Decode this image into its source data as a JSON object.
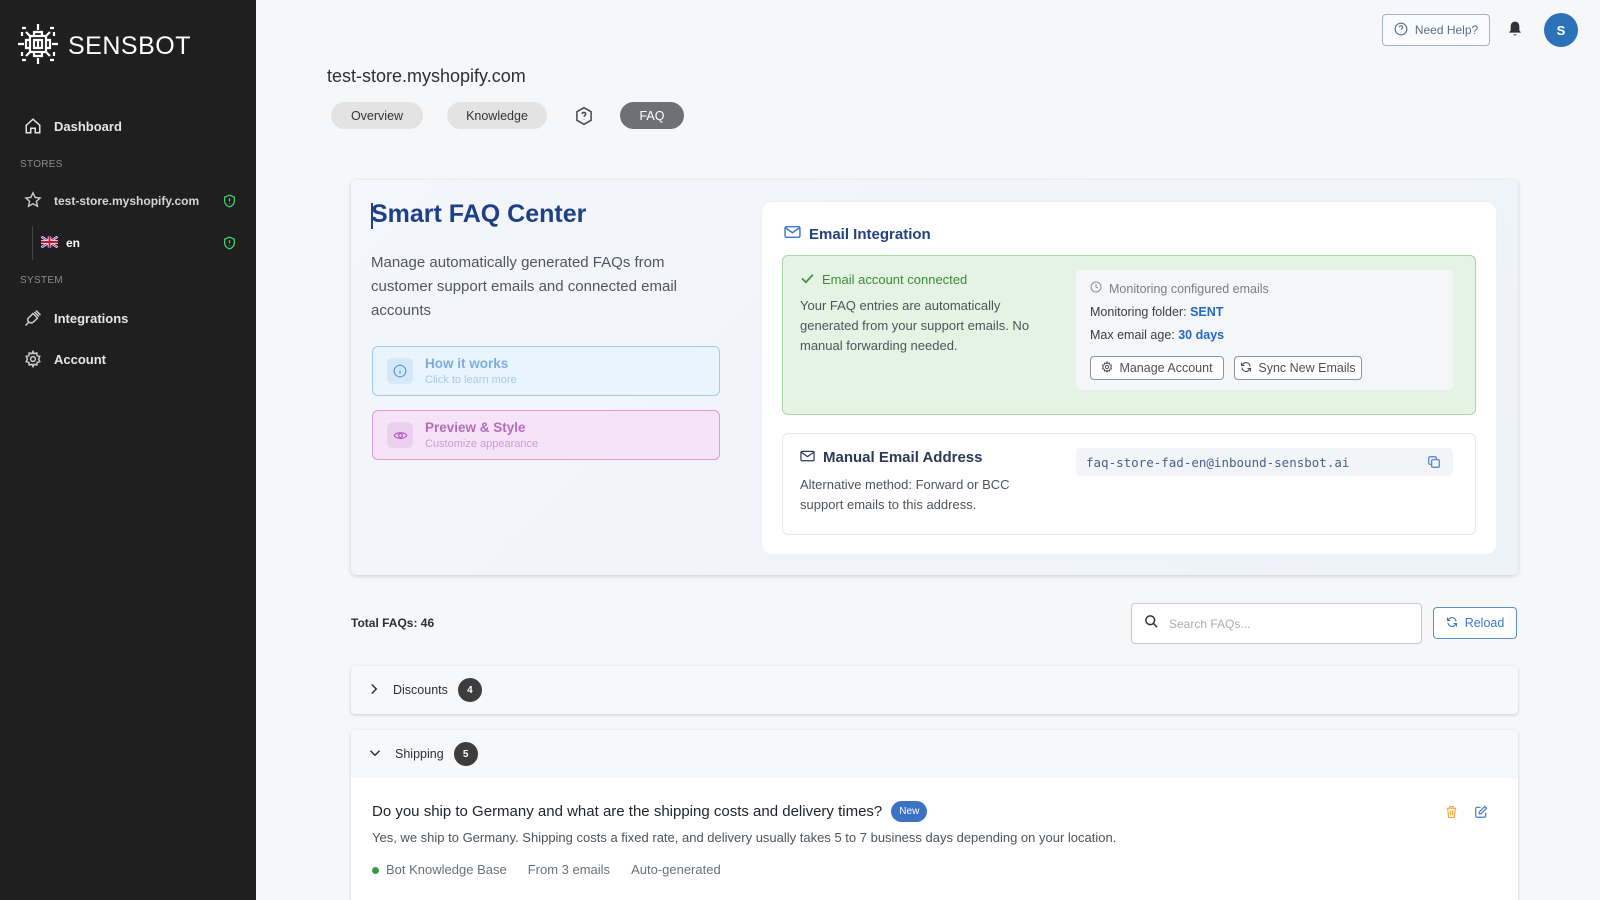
{
  "app": {
    "logo_text": "SENSBOT"
  },
  "sidebar": {
    "dashboard_label": "Dashboard",
    "stores_section": "STORES",
    "store_name": "test-store.myshopify.com",
    "language": "en",
    "system_section": "SYSTEM",
    "integrations_label": "Integrations",
    "account_label": "Account"
  },
  "topbar": {
    "help_label": "Need Help?",
    "avatar_initial": "S"
  },
  "header": {
    "store_title": "test-store.myshopify.com",
    "tabs": [
      {
        "label": "Overview"
      },
      {
        "label": "Knowledge"
      },
      {
        "label": "FAQ"
      }
    ]
  },
  "faq_center": {
    "title": "Smart FAQ Center",
    "description": "Manage automatically generated FAQs from customer support emails and connected email accounts",
    "how_it_works": {
      "title": "How it works",
      "subtitle": "Click to learn more"
    },
    "preview_style": {
      "title": "Preview & Style",
      "subtitle": "Customize appearance"
    }
  },
  "email_integration": {
    "title": "Email Integration",
    "connected_title": "Email account connected",
    "connected_desc": "Your FAQ entries are automatically generated from your support emails. No manual forwarding needed.",
    "monitoring_head": "Monitoring configured emails",
    "folder_label": "Monitoring folder: ",
    "folder_value": "SENT",
    "age_label": "Max email age: ",
    "age_value": "30 days",
    "manage_btn": "Manage Account",
    "sync_btn": "Sync New Emails",
    "manual_title": "Manual Email Address",
    "manual_desc": "Alternative method: Forward or BCC support emails to this address.",
    "manual_email": "faq-store-fad-en@inbound-sensbot.ai"
  },
  "faq_list": {
    "total": "Total FAQs: 46",
    "search_placeholder": "Search FAQs...",
    "reload_label": "Reload",
    "groups": [
      {
        "name": "Discounts",
        "count": "4",
        "expanded": false
      },
      {
        "name": "Shipping",
        "count": "5",
        "expanded": true
      }
    ],
    "item": {
      "question": "Do you ship to Germany and what are the shipping costs and delivery times?",
      "badge": "New",
      "answer": "Yes, we ship to Germany. Shipping costs a fixed rate, and delivery usually takes 5 to 7 business days depending on your location.",
      "source": "Bot Knowledge Base",
      "emails": "From 3 emails",
      "origin": "Auto-generated"
    }
  },
  "colors": {
    "accent": "#2c72b8",
    "title_blue": "#1f3f86",
    "success": "#3c8c3c",
    "sidebar_bg": "#1f1f1f"
  }
}
